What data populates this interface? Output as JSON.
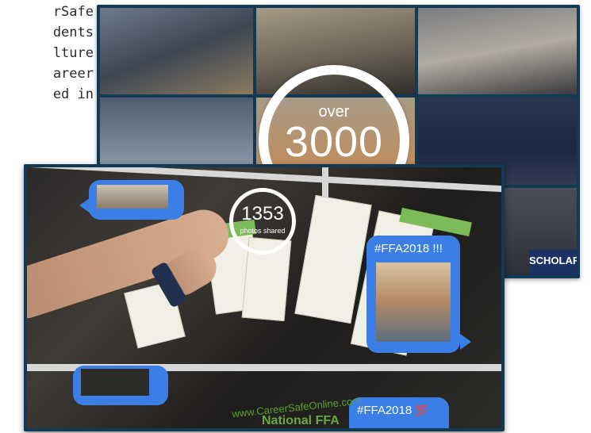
{
  "side_text": {
    "lines": [
      "rSafe",
      "dents",
      "lture",
      "areer",
      "ed in"
    ]
  },
  "back_collage": {
    "counter_top": "over",
    "counter_value": "3000",
    "banner_text": "SCHOLAR"
  },
  "front_collage": {
    "counter_value": "1353",
    "counter_caption": "photos shared",
    "bubble_right_tag": "#FFA2018 !!!",
    "bubble_bottom_tag": "#FFA2018",
    "bubble_bottom_emoji": "💯",
    "website_text": "www.CareerSafeOnline.com",
    "booth_title": "National FFA"
  },
  "colors": {
    "frame": "#123a55",
    "bubble": "#3b7ee6",
    "ring": "#ffffff"
  }
}
